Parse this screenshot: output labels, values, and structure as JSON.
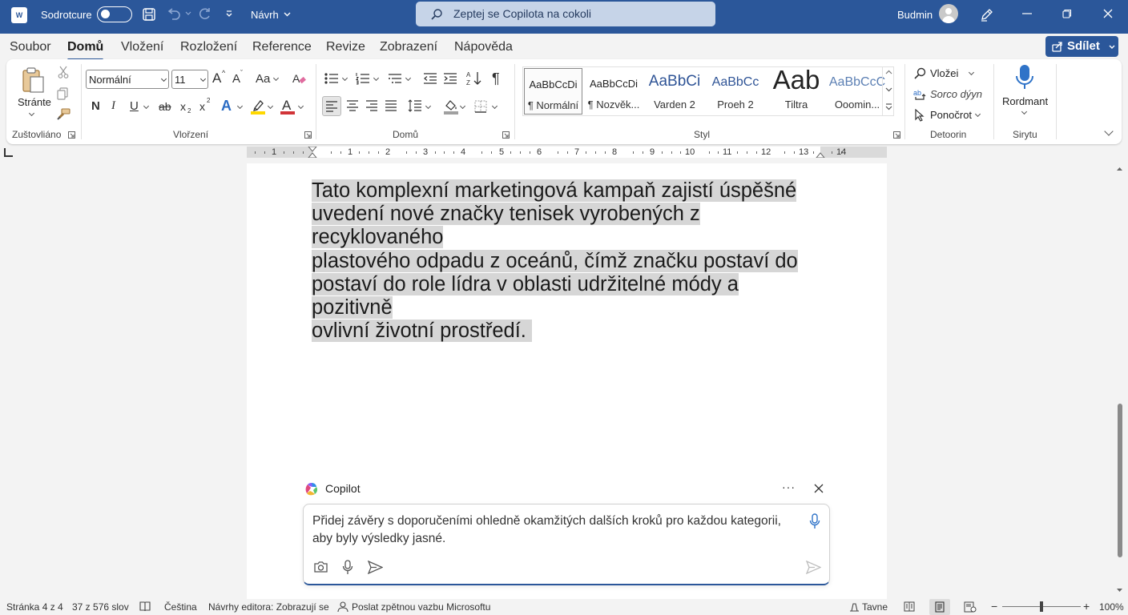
{
  "titlebar": {
    "app_icon": "word-doc-icon",
    "app_icon_text": "W",
    "autosave_label": "Sodrotcure",
    "doc_name": "Návrh",
    "search_placeholder": "Zeptej se Copilota na cokoli",
    "user_name": "Budmin"
  },
  "tabs": [
    "Soubor",
    "Domů",
    "Vložení",
    "Rozložení",
    "Reference",
    "Revize",
    "Zobrazení",
    "Nápověda"
  ],
  "active_tab": "Domů",
  "share_label": "Sdílet",
  "ribbon": {
    "clipboard": {
      "paste_label": "Stránte",
      "group_label": "Zuštovliáno"
    },
    "font": {
      "font_name": "Normální",
      "font_size": "11",
      "grow": "A",
      "shrink": "A",
      "change_case": "Aa",
      "bold": "N",
      "italic": "I",
      "underline": "U",
      "strikethrough": "ab",
      "subscript": "x",
      "superscript": "x",
      "text_effects": "A",
      "font_color": "A",
      "group_label": "Vlořzení"
    },
    "paragraph": {
      "group_label": "Domů",
      "pilcrow": "¶"
    },
    "styles": {
      "items": [
        {
          "preview": "AaBbCcDi",
          "name": "¶ Normální"
        },
        {
          "preview": "AaBbCcDi",
          "name": "¶ Nozvěk..."
        },
        {
          "preview": "AaBbCi",
          "name": "Varden 2"
        },
        {
          "preview": "AaBbCc",
          "name": "Proeh 2"
        },
        {
          "preview": "Aab",
          "name": "Tiltra"
        },
        {
          "preview": "AaBbCcC",
          "name": "Ooomin..."
        }
      ],
      "group_label": "Styl"
    },
    "editing": {
      "find": "Vložei",
      "replace": "Sorco dýyn",
      "select": "Ponočrot",
      "group_label": "Detoorin"
    },
    "voice": {
      "dictate": "Rordmant",
      "group_label": "Sirytu"
    }
  },
  "ruler": {
    "ticks": [
      "1",
      "1",
      "2",
      "3",
      "4",
      "5",
      "6",
      "7",
      "8",
      "9",
      "10",
      "11",
      "12",
      "13",
      "14"
    ]
  },
  "document": {
    "lines": [
      "Tato komplexní marketingová kampaň zajistí úspěšné",
      "uvedení nové značky tenisek vyrobených z recyklovaného",
      "plastového odpadu z oceánů, čímž značku postaví do",
      "postaví do role lídra v oblasti udržitelné módy a pozitivně",
      "ovlivní životní prostředí. "
    ]
  },
  "copilot": {
    "title": "Copilot",
    "more": "···",
    "prompt": "Přidej závěry s doporučeními ohledně okamžitých dalších kroků pro každou kategorii, aby byly výsledky jasné."
  },
  "status": {
    "page": "Stránka 4 z 4",
    "words": "37 z 576 slov",
    "language": "Čeština",
    "editor": "Návrhy editora: Zobrazují se",
    "feedback": "Poslat zpětnou vazbu Microsoftu",
    "focus": "Tavne",
    "zoom_minus": "−",
    "zoom_plus": "+",
    "zoom": "100%",
    "zoom_level": 0.5
  },
  "colors": {
    "brand": "#2b579a",
    "selection": "#d6d6d6",
    "font_color_bar": "#d13438",
    "highlight_bar": "#ffd800"
  }
}
